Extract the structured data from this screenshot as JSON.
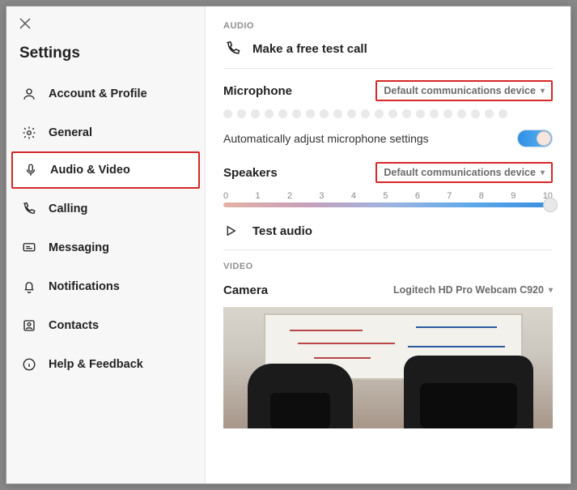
{
  "title": "Settings",
  "sidebar": {
    "items": [
      {
        "label": "Account & Profile",
        "icon": "user"
      },
      {
        "label": "General",
        "icon": "gear"
      },
      {
        "label": "Audio & Video",
        "icon": "microphone",
        "active": true
      },
      {
        "label": "Calling",
        "icon": "phone"
      },
      {
        "label": "Messaging",
        "icon": "message"
      },
      {
        "label": "Notifications",
        "icon": "bell"
      },
      {
        "label": "Contacts",
        "icon": "contacts"
      },
      {
        "label": "Help & Feedback",
        "icon": "info"
      }
    ]
  },
  "audio": {
    "section_label": "AUDIO",
    "test_call_label": "Make a free test call",
    "microphone": {
      "label": "Microphone",
      "selected": "Default communications device"
    },
    "auto_adjust_label": "Automatically adjust microphone settings",
    "auto_adjust_on": true,
    "speakers": {
      "label": "Speakers",
      "selected": "Default communications device",
      "scale": [
        "0",
        "1",
        "2",
        "3",
        "4",
        "5",
        "6",
        "7",
        "8",
        "9",
        "10"
      ],
      "value": 10
    },
    "test_audio_label": "Test audio"
  },
  "video": {
    "section_label": "VIDEO",
    "camera": {
      "label": "Camera",
      "selected": "Logitech HD Pro Webcam C920"
    }
  }
}
